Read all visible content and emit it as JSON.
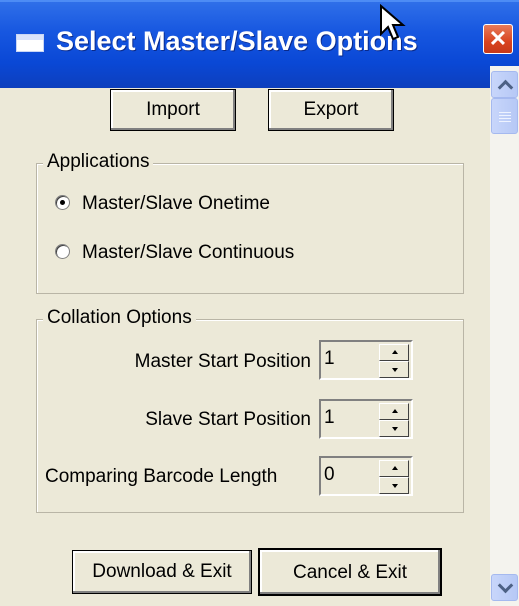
{
  "window": {
    "title": "Select Master/Slave Options",
    "close_symbol": "✕"
  },
  "toolbar": {
    "import_label": "Import",
    "export_label": "Export"
  },
  "applications": {
    "legend": "Applications",
    "options": [
      {
        "label": "Master/Slave Onetime",
        "selected": true
      },
      {
        "label": "Master/Slave Continuous",
        "selected": false
      }
    ]
  },
  "collation": {
    "legend": "Collation Options",
    "fields": [
      {
        "label": "Master Start Position",
        "value": "1"
      },
      {
        "label": "Slave Start Position",
        "value": "1"
      },
      {
        "label": "Comparing Barcode Length",
        "value": "0"
      }
    ]
  },
  "footer": {
    "download_label": "Download & Exit",
    "cancel_label": "Cancel & Exit"
  },
  "icons": {
    "window_icon": "window-icon",
    "close": "close-icon",
    "cursor": "mouse-cursor-icon",
    "scroll_up": "chevron-up-icon",
    "scroll_down": "chevron-down-icon"
  }
}
